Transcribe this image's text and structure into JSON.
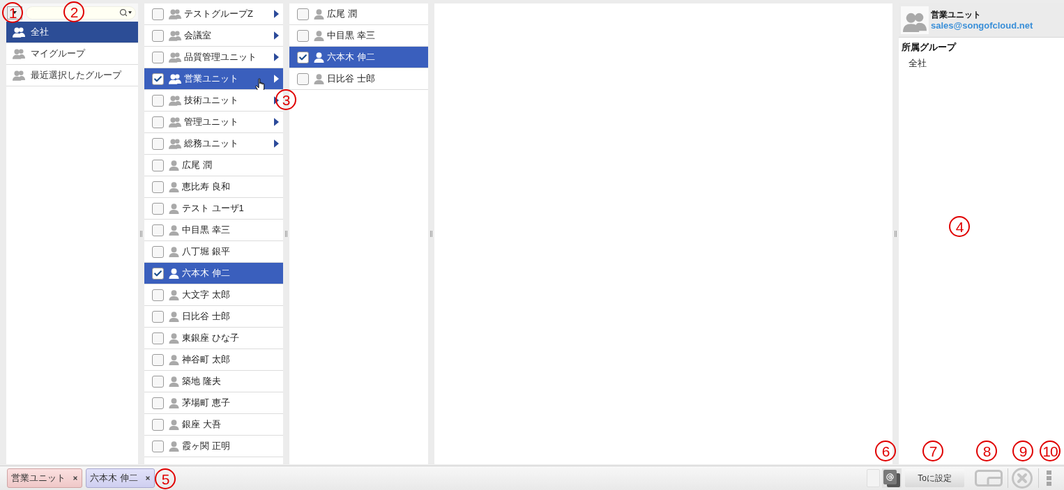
{
  "navigation": {
    "items": [
      {
        "label": "全社",
        "selected": true
      },
      {
        "label": "マイグループ",
        "selected": false
      },
      {
        "label": "最近選択したグループ",
        "selected": false
      }
    ]
  },
  "group_members": {
    "rows": [
      {
        "kind": "group",
        "label": "テストグループZ",
        "checked": false,
        "selected": false,
        "hover": false
      },
      {
        "kind": "group",
        "label": "会議室",
        "checked": false,
        "selected": false,
        "hover": false
      },
      {
        "kind": "group",
        "label": "品質管理ユニット",
        "checked": false,
        "selected": false,
        "hover": false
      },
      {
        "kind": "group",
        "label": "営業ユニット",
        "checked": true,
        "selected": true,
        "hover": true
      },
      {
        "kind": "group",
        "label": "技術ユニット",
        "checked": false,
        "selected": false,
        "hover": false
      },
      {
        "kind": "group",
        "label": "管理ユニット",
        "checked": false,
        "selected": false,
        "hover": false
      },
      {
        "kind": "group",
        "label": "総務ユニット",
        "checked": false,
        "selected": false,
        "hover": false
      },
      {
        "kind": "user",
        "label": "広尾 潤",
        "checked": false,
        "selected": false,
        "hover": false
      },
      {
        "kind": "user",
        "label": "恵比寿 良和",
        "checked": false,
        "selected": false,
        "hover": false
      },
      {
        "kind": "user",
        "label": "テスト ユーザ1",
        "checked": false,
        "selected": false,
        "hover": false
      },
      {
        "kind": "user",
        "label": "中目黒 幸三",
        "checked": false,
        "selected": false,
        "hover": false
      },
      {
        "kind": "user",
        "label": "八丁堀 銀平",
        "checked": false,
        "selected": false,
        "hover": false
      },
      {
        "kind": "user",
        "label": "六本木 伸二",
        "checked": true,
        "selected": true,
        "hover": false
      },
      {
        "kind": "user",
        "label": "大文字 太郎",
        "checked": false,
        "selected": false,
        "hover": false
      },
      {
        "kind": "user",
        "label": "日比谷 士郎",
        "checked": false,
        "selected": false,
        "hover": false
      },
      {
        "kind": "user",
        "label": "東銀座 ひな子",
        "checked": false,
        "selected": false,
        "hover": false
      },
      {
        "kind": "user",
        "label": "神谷町 太郎",
        "checked": false,
        "selected": false,
        "hover": false
      },
      {
        "kind": "user",
        "label": "築地 隆夫",
        "checked": false,
        "selected": false,
        "hover": false
      },
      {
        "kind": "user",
        "label": "茅場町 恵子",
        "checked": false,
        "selected": false,
        "hover": false
      },
      {
        "kind": "user",
        "label": "銀座 大吾",
        "checked": false,
        "selected": false,
        "hover": false
      },
      {
        "kind": "user",
        "label": "霞ヶ関 正明",
        "checked": false,
        "selected": false,
        "hover": false
      }
    ]
  },
  "sub_members": {
    "rows": [
      {
        "kind": "user",
        "label": "広尾 潤",
        "checked": false,
        "selected": false
      },
      {
        "kind": "user",
        "label": "中目黒 幸三",
        "checked": false,
        "selected": false
      },
      {
        "kind": "user",
        "label": "六本木 伸二",
        "checked": true,
        "selected": true
      },
      {
        "kind": "user",
        "label": "日比谷 士郎",
        "checked": false,
        "selected": false
      }
    ]
  },
  "detail": {
    "name": "営業ユニット",
    "email": "sales@songofcloud.net",
    "section_title": "所属グループ",
    "groups": [
      "全社"
    ]
  },
  "selection_bar": {
    "chips": [
      {
        "kind": "group",
        "label": "営業ユニット"
      },
      {
        "kind": "user",
        "label": "六本木 伸二"
      }
    ],
    "set_to_button": "Toに設定"
  },
  "callouts": [
    {
      "label": "1"
    },
    {
      "label": "2"
    },
    {
      "label": "3"
    },
    {
      "label": "4"
    },
    {
      "label": "5"
    },
    {
      "label": "6"
    },
    {
      "label": "7"
    },
    {
      "label": "8"
    },
    {
      "label": "9"
    },
    {
      "label": "10"
    }
  ]
}
